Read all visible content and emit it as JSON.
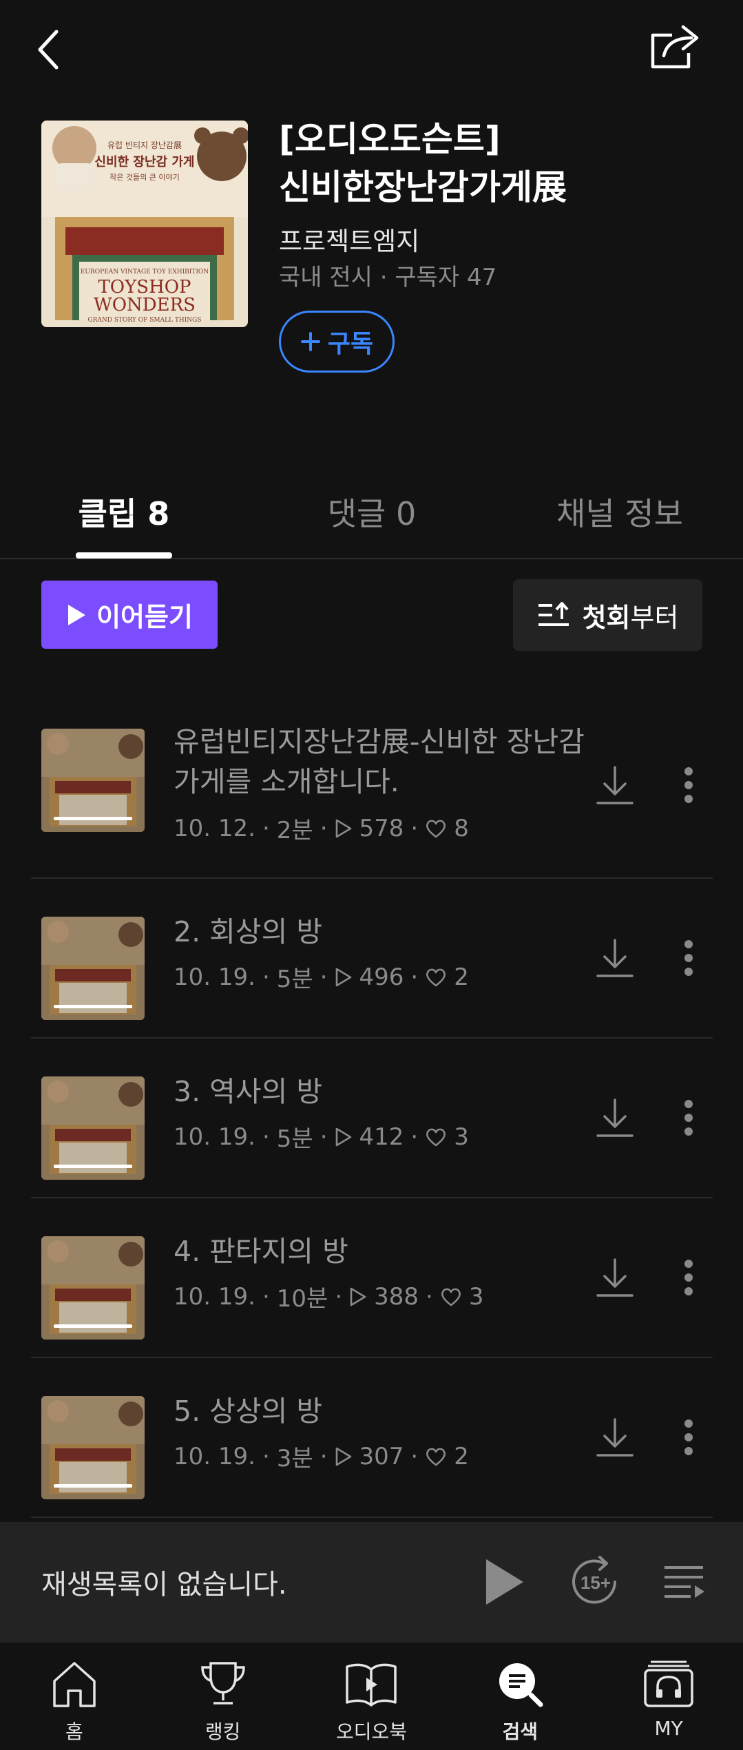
{
  "header": {
    "back_icon": "chevron-left-icon",
    "share_icon": "share-icon"
  },
  "channel": {
    "title": "[오디오도슨트]\n신비한장난감가게展",
    "author": "프로젝트엠지",
    "meta": "국내 전시 · 구독자 47",
    "subscribe_label": "구독",
    "cover": {
      "line1": "유럽 빈티지 장난감展",
      "line2": "신비한 장난감 가게",
      "line3": "작은 것들의 큰 이야기",
      "en_line1": "EUROPEAN VINTAGE TOY EXHIBITION",
      "en_line2": "TOYSHOP",
      "en_line3": "WONDERS",
      "en_line4": "GRAND STORY OF SMALL THINGS"
    }
  },
  "tabs": [
    {
      "label": "클립 8",
      "active": true
    },
    {
      "label": "댓글 0",
      "active": false
    },
    {
      "label": "채널 정보",
      "active": false
    }
  ],
  "actions": {
    "continue_label": "이어듣기",
    "sort_bold": "첫회",
    "sort_rest": "부터"
  },
  "clips": [
    {
      "title": "유럽빈티지장난감展-신비한 장난감\n가게를 소개합니다.",
      "date": "10. 12.",
      "duration": "2분",
      "plays": "578",
      "likes": "8"
    },
    {
      "title": "2. 회상의 방",
      "date": "10. 19.",
      "duration": "5분",
      "plays": "496",
      "likes": "2"
    },
    {
      "title": "3. 역사의 방",
      "date": "10. 19.",
      "duration": "5분",
      "plays": "412",
      "likes": "3"
    },
    {
      "title": "4. 판타지의 방",
      "date": "10. 19.",
      "duration": "10분",
      "plays": "388",
      "likes": "3"
    },
    {
      "title": "5. 상상의 방",
      "date": "10. 19.",
      "duration": "3분",
      "plays": "307",
      "likes": "2"
    }
  ],
  "player": {
    "empty_text": "재생목록이 없습니다.",
    "skip_label": "15+"
  },
  "nav": [
    {
      "label": "홈",
      "icon": "home-icon",
      "active": false
    },
    {
      "label": "랭킹",
      "icon": "trophy-icon",
      "active": false
    },
    {
      "label": "오디오북",
      "icon": "audiobook-icon",
      "active": false
    },
    {
      "label": "검색",
      "icon": "search-icon",
      "active": true
    },
    {
      "label": "MY",
      "icon": "headphones-icon",
      "active": false
    }
  ],
  "colors": {
    "background": "#121212",
    "accent_purple": "#7b4dff",
    "accent_blue": "#3a86ff"
  }
}
